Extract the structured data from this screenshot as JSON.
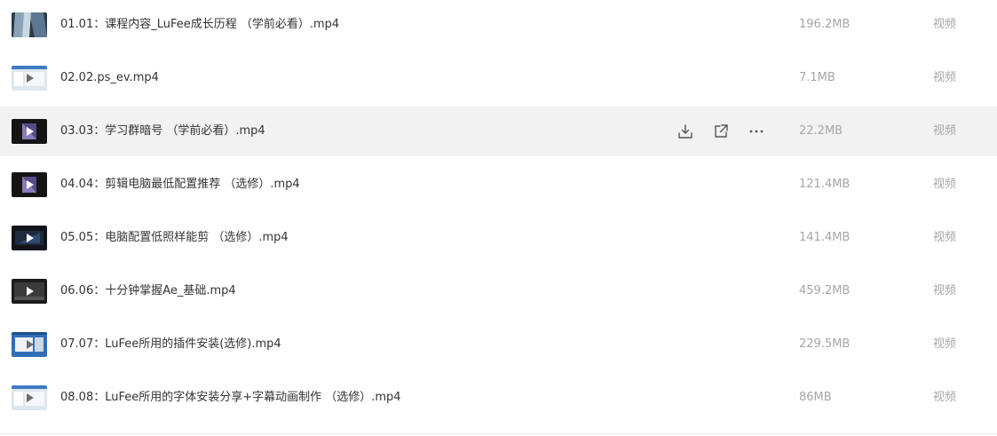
{
  "files": [
    {
      "name": "01.01：课程内容_LuFee成长历程 （学前必看）.mp4",
      "size": "196.2MB",
      "type": "视频",
      "thumb": "glass-building",
      "hovered": false
    },
    {
      "name": "02.02.ps_ev.mp4",
      "size": "7.1MB",
      "type": "视频",
      "thumb": "screen-light",
      "hovered": false
    },
    {
      "name": "03.03：学习群暗号 （学前必看）.mp4",
      "size": "22.2MB",
      "type": "视频",
      "thumb": "dark-purple",
      "hovered": true
    },
    {
      "name": "04.04：剪辑电脑最低配置推荐 （选修）.mp4",
      "size": "121.4MB",
      "type": "视频",
      "thumb": "dark-purple",
      "hovered": false
    },
    {
      "name": "05.05：电脑配置低照样能剪 （选修）.mp4",
      "size": "141.4MB",
      "type": "视频",
      "thumb": "dark-blue",
      "hovered": false
    },
    {
      "name": "06.06：十分钟掌握Ae_基础.mp4",
      "size": "459.2MB",
      "type": "视频",
      "thumb": "dark-gray",
      "hovered": false
    },
    {
      "name": "07.07：LuFee所用的插件安装(选修).mp4",
      "size": "229.5MB",
      "type": "视频",
      "thumb": "screen-blue",
      "hovered": false
    },
    {
      "name": "08.08：LuFee所用的字体安装分享+字幕动画制作 （选修）.mp4",
      "size": "86MB",
      "type": "视频",
      "thumb": "screen-light",
      "hovered": false
    }
  ],
  "row_actions": {
    "download_icon": "download-icon",
    "share_icon": "share-icon",
    "more_icon": "more-icon"
  },
  "colors": {
    "text": "#333333",
    "muted": "#a6a6a6",
    "hover_bg": "#f2f2f2",
    "icon": "#555555"
  }
}
